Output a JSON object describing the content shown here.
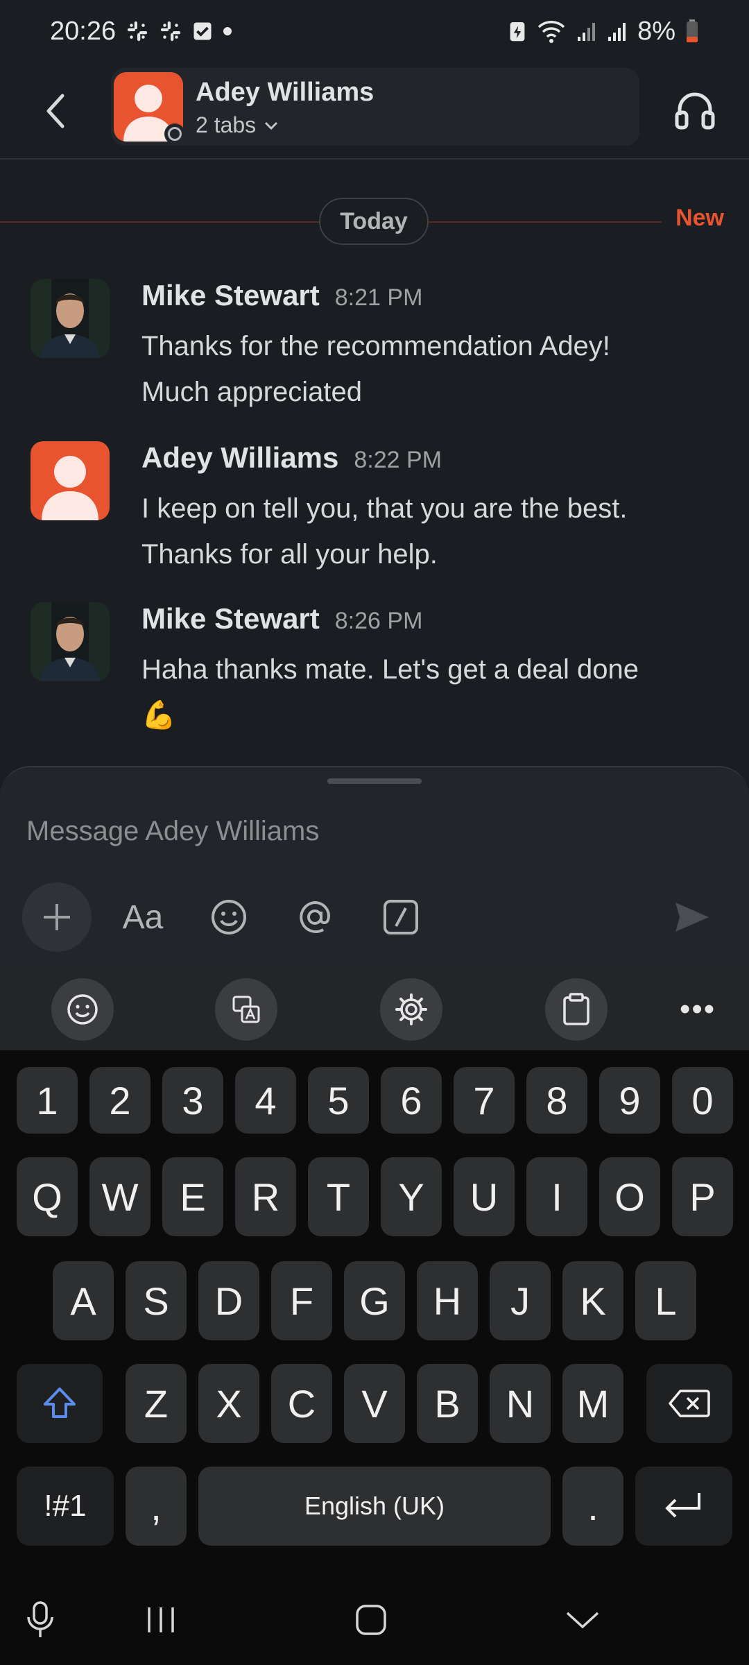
{
  "status_bar": {
    "time": "20:26",
    "battery": "8%"
  },
  "header": {
    "contact_name": "Adey Williams",
    "tabs_label": "2 tabs"
  },
  "conversation": {
    "day_label": "Today",
    "new_label": "New",
    "messages": [
      {
        "author": "Mike Stewart",
        "time": "8:21 PM",
        "line1": "Thanks for the recommendation Adey!",
        "line2": "Much appreciated"
      },
      {
        "author": "Adey Williams",
        "time": "8:22 PM",
        "line1": "I keep on tell you, that you are the best.",
        "line2": "Thanks for all your help."
      },
      {
        "author": "Mike Stewart",
        "time": "8:26 PM",
        "line1": "Haha thanks mate. Let's get a deal done",
        "line2": "💪"
      }
    ]
  },
  "composer": {
    "placeholder": "Message Adey Williams",
    "format_label": "Aa"
  },
  "keyboard": {
    "number_row": [
      "1",
      "2",
      "3",
      "4",
      "5",
      "6",
      "7",
      "8",
      "9",
      "0"
    ],
    "row1": [
      "Q",
      "W",
      "E",
      "R",
      "T",
      "Y",
      "U",
      "I",
      "O",
      "P"
    ],
    "row2": [
      "A",
      "S",
      "D",
      "F",
      "G",
      "H",
      "J",
      "K",
      "L"
    ],
    "row3": [
      "Z",
      "X",
      "C",
      "V",
      "B",
      "N",
      "M"
    ],
    "symbols_label": "!#1",
    "comma_label": ",",
    "space_label": "English (UK)",
    "period_label": ".",
    "more_label": "•••"
  },
  "colors": {
    "background": "#1a1d21",
    "accent_new": "#e8542f",
    "avatar_orange": "#e8542f",
    "shift_blue": "#5b8def"
  }
}
